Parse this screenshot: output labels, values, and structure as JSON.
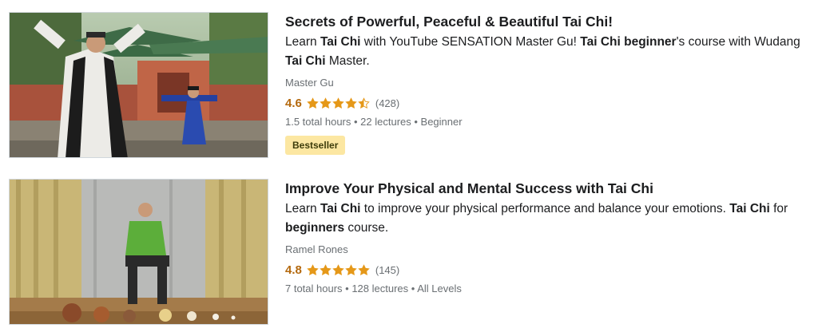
{
  "courses": [
    {
      "title": "Secrets of Powerful, Peaceful & Beautiful Tai Chi!",
      "description": [
        {
          "text": "Learn ",
          "bold": false
        },
        {
          "text": "Tai Chi",
          "bold": true
        },
        {
          "text": " with YouTube SENSATION Master Gu! ",
          "bold": false
        },
        {
          "text": "Tai Chi beginner",
          "bold": true
        },
        {
          "text": "'s course with Wudang ",
          "bold": false
        },
        {
          "text": "Tai Chi",
          "bold": true
        },
        {
          "text": " Master.",
          "bold": false
        }
      ],
      "instructor": "Master Gu",
      "rating": "4.6",
      "stars": 4.5,
      "reviews": "(428)",
      "meta": "1.5 total hours • 22 lectures • Beginner",
      "badge": "Bestseller"
    },
    {
      "title": "Improve Your Physical and Mental Success with Tai Chi",
      "description": [
        {
          "text": "Learn ",
          "bold": false
        },
        {
          "text": "Tai Chi",
          "bold": true
        },
        {
          "text": " to improve your physical performance and balance your emotions. ",
          "bold": false
        },
        {
          "text": "Tai Chi",
          "bold": true
        },
        {
          "text": " for ",
          "bold": false
        },
        {
          "text": "beginners",
          "bold": true
        },
        {
          "text": " course.",
          "bold": false
        }
      ],
      "instructor": "Ramel Rones",
      "rating": "4.8",
      "stars": 5,
      "reviews": "(145)",
      "meta": "7 total hours • 128 lectures • All Levels",
      "badge": ""
    }
  ],
  "colors": {
    "rating": "#b4690e",
    "star": "#e59819",
    "badge_bg": "#fce7a2",
    "muted": "#6a6f73"
  }
}
